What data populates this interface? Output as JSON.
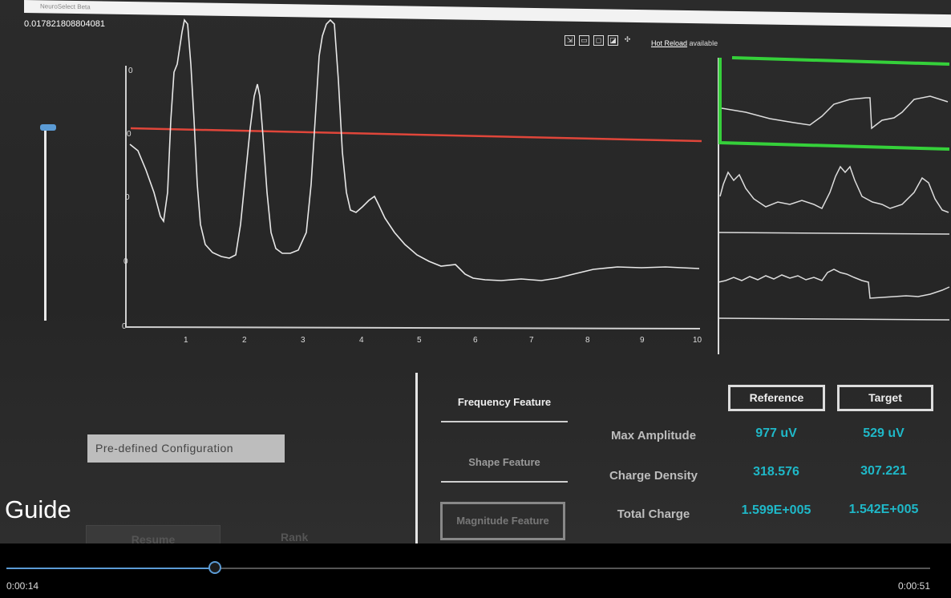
{
  "window": {
    "title": "NeuroSelect Beta"
  },
  "readout": {
    "value": "0.017821808804081"
  },
  "toolbar": {
    "icons": [
      "goto-live-tree-icon",
      "select-element-icon",
      "display-layout-adorners-icon",
      "track-focused-element-icon",
      "binding-failures-icon"
    ]
  },
  "hot_reload": {
    "link": "Hot Reload",
    "text": "available"
  },
  "main_plot": {
    "x_ticks": [
      "1",
      "2",
      "3",
      "4",
      "5",
      "6",
      "7",
      "8",
      "9",
      "10"
    ],
    "y_ticks": [
      "0",
      "0",
      "0",
      "0",
      "0"
    ],
    "threshold_color": "#e0463a",
    "trace_color": "#e8e8e8"
  },
  "thumbnails": {
    "selected_color": "#35d03a"
  },
  "left_panel": {
    "config_button": "Pre-defined Configuration",
    "resume_button": "Resume",
    "rank_label": "Rank"
  },
  "features": {
    "frequency": "Frequency Feature",
    "shape": "Shape Feature",
    "magnitude": "Magnitude Feature"
  },
  "comparison": {
    "reference_label": "Reference",
    "target_label": "Target",
    "rows": [
      {
        "label": "Max Amplitude",
        "reference": "977 uV",
        "target": "529 uV"
      },
      {
        "label": "Charge Density",
        "reference": "318.576",
        "target": "307.221"
      },
      {
        "label": "Total Charge",
        "reference": "1.599E+005",
        "target": "1.542E+005"
      }
    ],
    "value_color": "#1fb8c8"
  },
  "caption": "Guide",
  "player": {
    "current_time": "0:00:14",
    "total_time": "0:00:51",
    "progress": 0.226,
    "accent": "#5b9bd5"
  }
}
